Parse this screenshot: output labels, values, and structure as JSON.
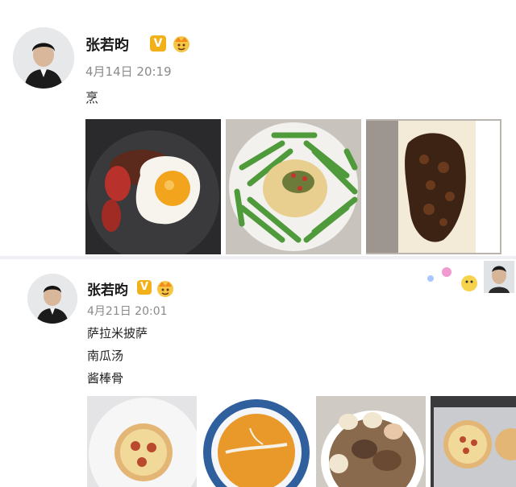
{
  "posts": [
    {
      "username": "张若昀",
      "verified_badge": "V",
      "timestamp": "4月14日 20:19",
      "text_lines": [
        "烹"
      ],
      "photo_icons": [
        "fried-egg-rice-photo",
        "green-beans-rice-photo",
        "meat-toast-photo"
      ]
    },
    {
      "username": "张若昀",
      "verified_badge": "V",
      "timestamp": "4月21日 20:01",
      "text_lines": [
        "萨拉米披萨",
        "南瓜汤",
        "酱棒骨"
      ],
      "photo_icons": [
        "salami-pizza-photo",
        "pumpkin-soup-photo",
        "braised-bones-photo",
        "tray-pizza-photo"
      ]
    }
  ],
  "colors": {
    "badge": "#f2b019",
    "timestamp": "#8a8a8a",
    "background": "#eef0f3"
  }
}
